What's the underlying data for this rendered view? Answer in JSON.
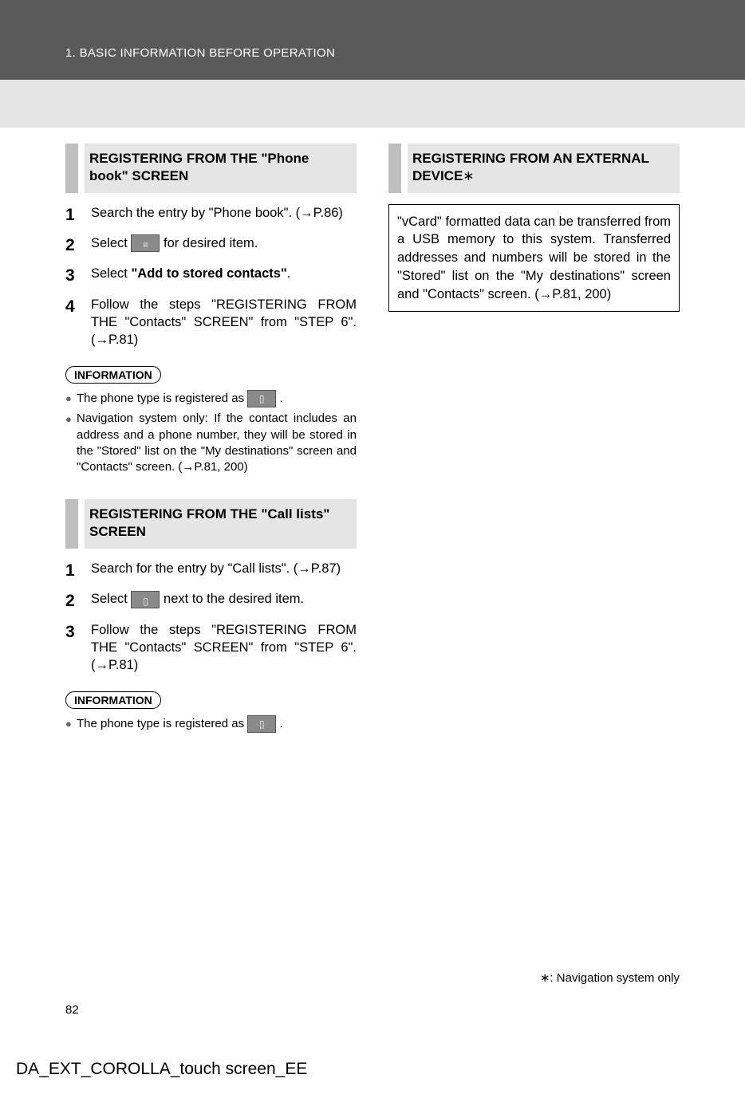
{
  "header": {
    "breadcrumb": "1. BASIC INFORMATION BEFORE OPERATION"
  },
  "left": {
    "sec1": {
      "title": "REGISTERING FROM THE \"Phone book\" SCREEN",
      "step1": "Search the entry by \"Phone book\". (→P.86)",
      "step2a": "Select ",
      "step2b": " for desired item.",
      "step3a": "Select ",
      "step3b": "\"Add to stored contacts\"",
      "step3c": ".",
      "step4": "Follow the steps \"REGISTERING FROM THE \"Contacts\" SCREEN\" from \"STEP 6\". (→P.81)",
      "info_label": "INFORMATION",
      "info_b1a": "The phone type is registered as ",
      "info_b1b": ".",
      "info_b2": "Navigation system only: If the contact includes an address and a phone number, they will be stored in the \"Stored\" list on the \"My destinations\" screen and \"Contacts\" screen. (→P.81, 200)"
    },
    "sec2": {
      "title": "REGISTERING FROM THE \"Call lists\" SCREEN",
      "step1": "Search for the entry by \"Call lists\". (→P.87)",
      "step2a": "Select ",
      "step2b": " next to the desired item.",
      "step3": "Follow the steps \"REGISTERING FROM THE \"Contacts\" SCREEN\" from \"STEP 6\". (→P.81)",
      "info_label": "INFORMATION",
      "info_b1a": "The phone type is registered as ",
      "info_b1b": "."
    }
  },
  "right": {
    "sec1": {
      "title": "REGISTERING FROM AN EXTERNAL DEVICE",
      "title_star": "∗",
      "box": "\"vCard\" formatted data can be transferred from a USB memory to this system. Transferred addresses and numbers will be stored in the \"Stored\" list on the \"My destinations\" screen and \"Contacts\" screen. (→P.81, 200)"
    }
  },
  "footnote": "∗: Navigation system only",
  "pagenum": "82",
  "footer": "DA_EXT_COROLLA_touch screen_EE",
  "icons": {
    "options": "≡",
    "phone": "▯",
    "phone2": "▯"
  }
}
